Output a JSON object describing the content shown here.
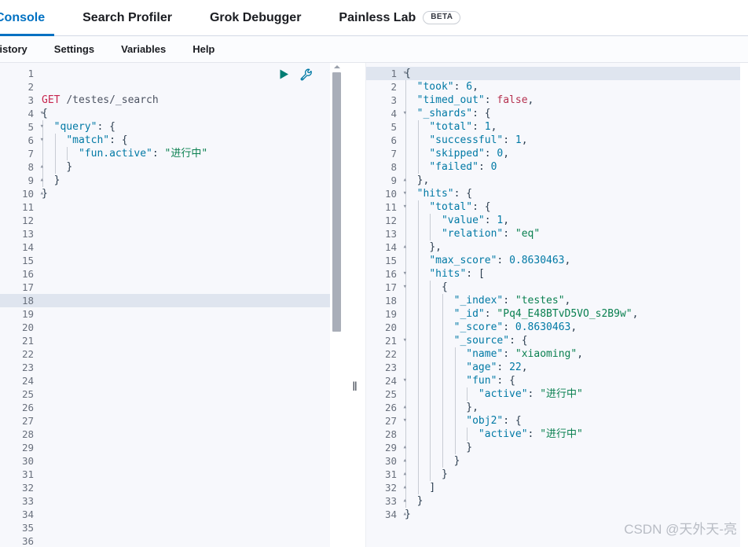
{
  "tabs": [
    {
      "label": "Console",
      "active": true,
      "badge": null
    },
    {
      "label": "Search Profiler",
      "active": false,
      "badge": null
    },
    {
      "label": "Grok Debugger",
      "active": false,
      "badge": null
    },
    {
      "label": "Painless Lab",
      "active": false,
      "badge": "BETA"
    }
  ],
  "menu": [
    {
      "label": "History"
    },
    {
      "label": "Settings"
    },
    {
      "label": "Variables"
    },
    {
      "label": "Help"
    }
  ],
  "editor": {
    "actions": [
      {
        "name": "play-icon",
        "title": "Click to send request"
      },
      {
        "name": "wrench-icon",
        "title": "Open documentation"
      }
    ],
    "active_line": 18,
    "total_lines": 36,
    "request_method": "GET",
    "request_path": "/testes/_search",
    "request_body": "{\n  \"query\": {\n    \"match\": {\n      \"fun.active\": \"进行中\"\n    }\n  }\n}",
    "lines": [
      {
        "n": 1,
        "fold": "",
        "text": ""
      },
      {
        "n": 2,
        "fold": "",
        "text": ""
      },
      {
        "n": 3,
        "fold": "",
        "text": "GET /testes/_search"
      },
      {
        "n": 4,
        "fold": "▾",
        "text": "{"
      },
      {
        "n": 5,
        "fold": "▾",
        "text": "  \"query\": {"
      },
      {
        "n": 6,
        "fold": "▾",
        "text": "    \"match\": {"
      },
      {
        "n": 7,
        "fold": "",
        "text": "      \"fun.active\": \"进行中\""
      },
      {
        "n": 8,
        "fold": "▴",
        "text": "    }"
      },
      {
        "n": 9,
        "fold": "▴",
        "text": "  }"
      },
      {
        "n": 10,
        "fold": "▴",
        "text": "}"
      },
      {
        "n": 11,
        "fold": "",
        "text": ""
      },
      {
        "n": 12,
        "fold": "",
        "text": ""
      },
      {
        "n": 13,
        "fold": "",
        "text": ""
      },
      {
        "n": 14,
        "fold": "",
        "text": ""
      },
      {
        "n": 15,
        "fold": "",
        "text": ""
      },
      {
        "n": 16,
        "fold": "",
        "text": ""
      },
      {
        "n": 17,
        "fold": "",
        "text": ""
      },
      {
        "n": 18,
        "fold": "",
        "text": ""
      },
      {
        "n": 19,
        "fold": "",
        "text": ""
      },
      {
        "n": 20,
        "fold": "",
        "text": ""
      },
      {
        "n": 21,
        "fold": "",
        "text": ""
      },
      {
        "n": 22,
        "fold": "",
        "text": ""
      },
      {
        "n": 23,
        "fold": "",
        "text": ""
      },
      {
        "n": 24,
        "fold": "",
        "text": ""
      },
      {
        "n": 25,
        "fold": "",
        "text": ""
      },
      {
        "n": 26,
        "fold": "",
        "text": ""
      },
      {
        "n": 27,
        "fold": "",
        "text": ""
      },
      {
        "n": 28,
        "fold": "",
        "text": ""
      },
      {
        "n": 29,
        "fold": "",
        "text": ""
      },
      {
        "n": 30,
        "fold": "",
        "text": ""
      },
      {
        "n": 31,
        "fold": "",
        "text": ""
      },
      {
        "n": 32,
        "fold": "",
        "text": ""
      },
      {
        "n": 33,
        "fold": "",
        "text": ""
      },
      {
        "n": 34,
        "fold": "",
        "text": ""
      },
      {
        "n": 35,
        "fold": "",
        "text": ""
      },
      {
        "n": 36,
        "fold": "",
        "text": ""
      }
    ]
  },
  "response": {
    "active_line": 1,
    "total_lines": 34,
    "took": 6,
    "timed_out": false,
    "shards": {
      "total": 1,
      "successful": 1,
      "skipped": 0,
      "failed": 0
    },
    "hits_total": {
      "value": 1,
      "relation": "eq"
    },
    "max_score": 0.8630463,
    "hit": {
      "_index": "testes",
      "_id": "Pq4_E48BTvD5VO_s2B9w",
      "_score": 0.8630463,
      "_source": {
        "name": "xiaoming",
        "age": 22,
        "fun": {
          "active": "进行中"
        },
        "obj2": {
          "active": "进行中"
        }
      }
    },
    "lines": [
      {
        "n": 1,
        "fold": "▾",
        "text": "{"
      },
      {
        "n": 2,
        "fold": "",
        "text": "  \"took\": 6,"
      },
      {
        "n": 3,
        "fold": "",
        "text": "  \"timed_out\": false,"
      },
      {
        "n": 4,
        "fold": "▾",
        "text": "  \"_shards\": {"
      },
      {
        "n": 5,
        "fold": "",
        "text": "    \"total\": 1,"
      },
      {
        "n": 6,
        "fold": "",
        "text": "    \"successful\": 1,"
      },
      {
        "n": 7,
        "fold": "",
        "text": "    \"skipped\": 0,"
      },
      {
        "n": 8,
        "fold": "",
        "text": "    \"failed\": 0"
      },
      {
        "n": 9,
        "fold": "▴",
        "text": "  },"
      },
      {
        "n": 10,
        "fold": "▾",
        "text": "  \"hits\": {"
      },
      {
        "n": 11,
        "fold": "▾",
        "text": "    \"total\": {"
      },
      {
        "n": 12,
        "fold": "",
        "text": "      \"value\": 1,"
      },
      {
        "n": 13,
        "fold": "",
        "text": "      \"relation\": \"eq\""
      },
      {
        "n": 14,
        "fold": "▴",
        "text": "    },"
      },
      {
        "n": 15,
        "fold": "",
        "text": "    \"max_score\": 0.8630463,"
      },
      {
        "n": 16,
        "fold": "▾",
        "text": "    \"hits\": ["
      },
      {
        "n": 17,
        "fold": "▾",
        "text": "      {"
      },
      {
        "n": 18,
        "fold": "",
        "text": "        \"_index\": \"testes\","
      },
      {
        "n": 19,
        "fold": "",
        "text": "        \"_id\": \"Pq4_E48BTvD5VO_s2B9w\","
      },
      {
        "n": 20,
        "fold": "",
        "text": "        \"_score\": 0.8630463,"
      },
      {
        "n": 21,
        "fold": "▾",
        "text": "        \"_source\": {"
      },
      {
        "n": 22,
        "fold": "",
        "text": "          \"name\": \"xiaoming\","
      },
      {
        "n": 23,
        "fold": "",
        "text": "          \"age\": 22,"
      },
      {
        "n": 24,
        "fold": "▾",
        "text": "          \"fun\": {"
      },
      {
        "n": 25,
        "fold": "",
        "text": "            \"active\": \"进行中\""
      },
      {
        "n": 26,
        "fold": "▴",
        "text": "          },"
      },
      {
        "n": 27,
        "fold": "▾",
        "text": "          \"obj2\": {"
      },
      {
        "n": 28,
        "fold": "",
        "text": "            \"active\": \"进行中\""
      },
      {
        "n": 29,
        "fold": "▴",
        "text": "          }"
      },
      {
        "n": 30,
        "fold": "▴",
        "text": "        }"
      },
      {
        "n": 31,
        "fold": "▴",
        "text": "      }"
      },
      {
        "n": 32,
        "fold": "▴",
        "text": "    ]"
      },
      {
        "n": 33,
        "fold": "▴",
        "text": "  }"
      },
      {
        "n": 34,
        "fold": "▴",
        "text": "}"
      }
    ]
  },
  "watermark": "CSDN @天外天-亮",
  "colors": {
    "accent": "#0071c2",
    "method": "#c7254e",
    "key": "#0079a5",
    "string": "#0a8050",
    "bool": "#b5314f",
    "highlight": "#dfe5ef",
    "panel_bg": "#f7f8fc",
    "play_icon": "#017d73",
    "wrench_icon": "#0079a5"
  }
}
